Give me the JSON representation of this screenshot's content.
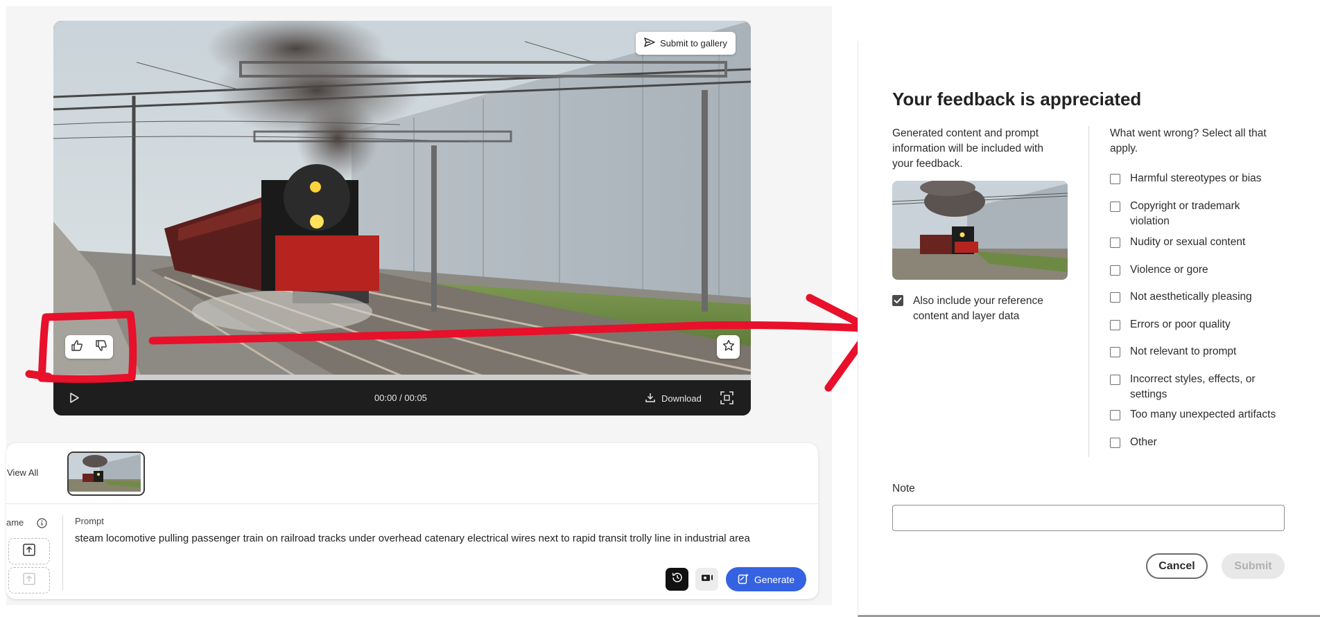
{
  "video": {
    "submit_to_gallery": "Submit to gallery",
    "time_display": "00:00 / 00:05",
    "download_label": "Download",
    "progress": 0
  },
  "generation_panel": {
    "view_all": "View All",
    "frame_label": "ame",
    "prompt_label": "Prompt",
    "prompt_text": "steam locomotive pulling passenger train on railroad tracks under overhead catenary electrical wires next to rapid transit trolly line in industrial area",
    "generate_label": "Generate"
  },
  "dialog": {
    "title": "Your feedback is appreciated",
    "info_text": "Generated content and prompt information will be included with your feedback.",
    "include_reference_label": "Also include your reference content and layer data",
    "include_reference_checked": true,
    "question": "What went wrong? Select all that apply.",
    "options": [
      {
        "label": "Harmful stereotypes or bias",
        "checked": false
      },
      {
        "label": "Copyright or trademark violation",
        "checked": false
      },
      {
        "label": "Nudity or sexual content",
        "checked": false
      },
      {
        "label": "Violence or gore",
        "checked": false
      },
      {
        "label": "Not aesthetically pleasing",
        "checked": false
      },
      {
        "label": "Errors or poor quality",
        "checked": false
      },
      {
        "label": "Not relevant to prompt",
        "checked": false
      },
      {
        "label": "Incorrect styles, effects, or settings",
        "checked": false
      },
      {
        "label": "Too many unexpected artifacts",
        "checked": false
      },
      {
        "label": "Other",
        "checked": false
      }
    ],
    "note_label": "Note",
    "note_value": "",
    "cancel_label": "Cancel",
    "submit_label": "Submit"
  },
  "colors": {
    "generate_blue": "#3562e0",
    "annotation_red": "#e8102a",
    "submit_disabled": "#e8e8e8"
  },
  "icons": [
    "send-icon",
    "thumbs-up-icon",
    "thumbs-down-icon",
    "star-icon",
    "play-icon",
    "download-icon",
    "fullscreen-icon",
    "info-icon",
    "upload-icon",
    "history-icon",
    "style-icon",
    "generate-icon",
    "checkmark-icon"
  ]
}
